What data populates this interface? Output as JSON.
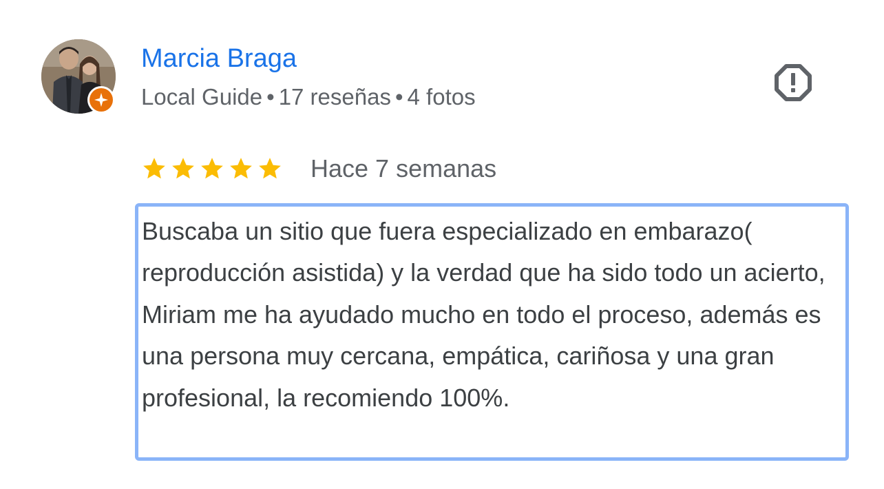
{
  "author": {
    "name": "Marcia Braga",
    "badge": "Local Guide",
    "reviews": "17 reseñas",
    "photos": "4 fotos",
    "separator": "•",
    "avatar_icon": "profile-photo",
    "badge_icon": "local-guide-star-icon"
  },
  "actions": {
    "report_icon": "report-flag-icon"
  },
  "review": {
    "rating": 5,
    "rating_max": 5,
    "date": "Hace 7 semanas",
    "text": "Buscaba un sitio que fuera especializado en embarazo( reproducción asistida) y la verdad que ha sido todo un acierto, Miriam me ha ayudado mucho en todo el proceso, además es una persona muy cercana, empática, cariñosa y una gran profesional, la recomiendo 100%."
  },
  "colors": {
    "name": "#1a73e8",
    "meta": "#5f6368",
    "star": "#fbbc04",
    "badge": "#e8710a",
    "selection_border": "#8ab4f8",
    "body_text": "#3c4043"
  }
}
